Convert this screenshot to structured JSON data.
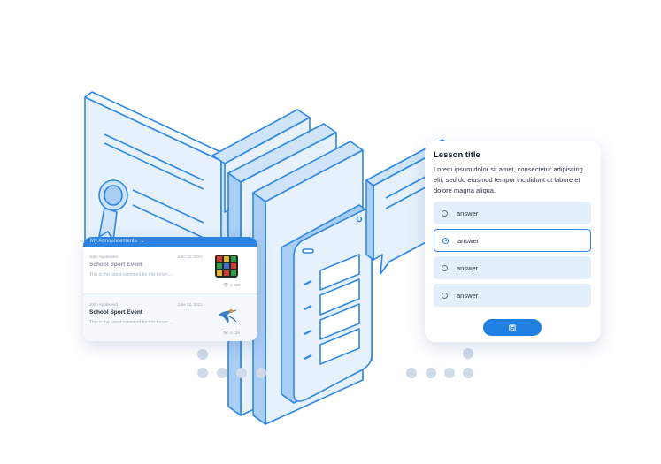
{
  "announcements": {
    "header": "My Announcements",
    "items": [
      {
        "author": "John Appleseed",
        "date": "June 12, 2021",
        "title": "School Sport Event",
        "comment": "This is the latest comment for this forum ...",
        "views": "4.12K",
        "thumbnail": "game-board-image"
      },
      {
        "author": "John Appleseed",
        "date": "June 12, 2021",
        "title": "School Sport Event",
        "comment": "This is the latest comment for this forum ...",
        "views": "4.12K",
        "thumbnail": "bird-image"
      }
    ]
  },
  "quiz": {
    "title": "Lesson title",
    "body": "Lorem ipsum dolor sit amet, consectetur adipiscing elit, sed do eiusmod tempor incididunt ut labore et dolore magna aliqua.",
    "answers": [
      {
        "label": "answer",
        "selected": false
      },
      {
        "label": "answer",
        "selected": true
      },
      {
        "label": "answer",
        "selected": false
      },
      {
        "label": "answer",
        "selected": false
      }
    ],
    "save_icon": "save-icon"
  },
  "colors": {
    "accent": "#1f7fe3",
    "line": "#2d88e6",
    "fill_light": "#e6f1fc",
    "dots": "#cfdbe9"
  },
  "icons": [
    "certificate-icon",
    "books-icon",
    "phone-icon",
    "speech-bubble-icon",
    "eye-icon",
    "chevron-down-icon"
  ]
}
